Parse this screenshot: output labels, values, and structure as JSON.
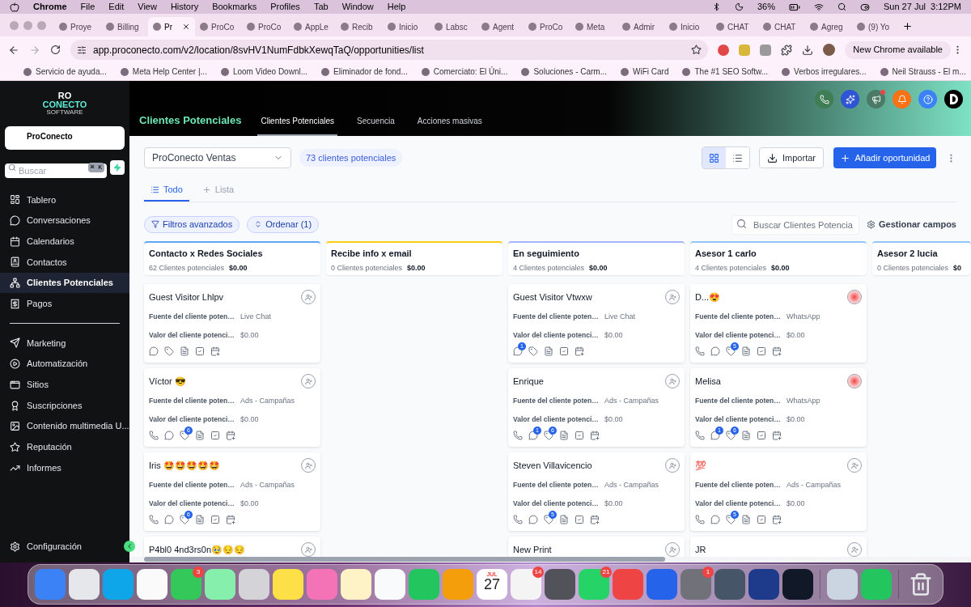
{
  "menubar": {
    "app": "Chrome",
    "menus": [
      "File",
      "Edit",
      "View",
      "History",
      "Bookmarks",
      "Profiles",
      "Tab",
      "Window",
      "Help"
    ],
    "battery": "36%",
    "clock": "Sun 27 Jul  3:12PM"
  },
  "browser_tabs": [
    {
      "title": "Proye",
      "selected": false
    },
    {
      "title": "Billing",
      "selected": false
    },
    {
      "title": "Pr",
      "selected": true
    },
    {
      "title": "ProCo",
      "selected": false
    },
    {
      "title": "ProCo",
      "selected": false
    },
    {
      "title": "AppLe",
      "selected": false
    },
    {
      "title": "Recib",
      "selected": false
    },
    {
      "title": "Inicio",
      "selected": false
    },
    {
      "title": "Labsc",
      "selected": false
    },
    {
      "title": "Agent",
      "selected": false
    },
    {
      "title": "ProCo",
      "selected": false
    },
    {
      "title": "Meta",
      "selected": false
    },
    {
      "title": "Admir",
      "selected": false
    },
    {
      "title": "Inicio",
      "selected": false
    },
    {
      "title": "CHAT",
      "selected": false
    },
    {
      "title": "CHAT",
      "selected": false
    },
    {
      "title": "Agreg",
      "selected": false
    },
    {
      "title": "(9) Yo",
      "selected": false
    }
  ],
  "address_bar": {
    "url": "app.proconecto.com/v2/location/8svHV1NumFdbkXewqTaQ/opportunities/list",
    "update_button": "New Chrome available"
  },
  "bookmarks": [
    "Servicio de ayuda...",
    "Meta Help Center |...",
    "Loom Video Downl...",
    "Eliminador de fond...",
    "Comerciato: El Úni...",
    "Soluciones - Carm...",
    "WiFi Card",
    "The #1 SEO Softw...",
    "Verbos irregulares...",
    "Neil Strauss - El m..."
  ],
  "sidebar": {
    "logo": {
      "top": "RO",
      "bottom": "CONECTO",
      "tagline": "SOFTWARE"
    },
    "account": "ProConecto",
    "search": {
      "placeholder": "Buscar",
      "shortcut": "⌘ K"
    },
    "nav_groups": [
      [
        {
          "label": "Tablero",
          "selected": false
        },
        {
          "label": "Conversaciones",
          "selected": false
        },
        {
          "label": "Calendarios",
          "selected": false
        },
        {
          "label": "Contactos",
          "selected": false
        },
        {
          "label": "Clientes Potenciales",
          "selected": true
        },
        {
          "label": "Pagos",
          "selected": false
        }
      ],
      [
        {
          "label": "Marketing",
          "selected": false
        },
        {
          "label": "Automatización",
          "selected": false
        },
        {
          "label": "Sitios",
          "selected": false
        },
        {
          "label": "Suscripciones",
          "selected": false
        },
        {
          "label": "Contenido multimedia U...",
          "selected": false
        },
        {
          "label": "Reputación",
          "selected": false
        },
        {
          "label": "Informes",
          "selected": false
        }
      ]
    ],
    "settings": "Configuración"
  },
  "header": {
    "title": "Clientes Potenciales",
    "tabs": [
      {
        "label": "Clientes Potenciales",
        "selected": true
      },
      {
        "label": "Secuencia",
        "selected": false
      },
      {
        "label": "Acciones masivas",
        "selected": false
      }
    ],
    "icons": [
      {
        "kind": "phone",
        "alert": false
      },
      {
        "kind": "ai",
        "alert": false
      },
      {
        "kind": "announce",
        "alert": true
      },
      {
        "kind": "bell",
        "alert": false
      },
      {
        "kind": "help",
        "alert": false
      },
      {
        "kind": "profile",
        "alert": false
      }
    ]
  },
  "toolbar": {
    "pipeline": "ProConecto Ventas",
    "count": "73 clientes potenciales",
    "view_modes": [
      {
        "kind": "grid",
        "selected": true
      },
      {
        "kind": "list",
        "selected": false
      }
    ],
    "import": "Importar",
    "add": "Añadir oportunidad"
  },
  "views": [
    {
      "kind": "view",
      "label": "Todo",
      "selected": true
    },
    {
      "kind": "add",
      "label": "Lista",
      "selected": false
    }
  ],
  "filters": {
    "advanced": "Filtros avanzados",
    "sort": "Ordenar (1)",
    "search_placeholder": "Buscar Clientes Potencia",
    "manage": "Gestionar campos"
  },
  "columns": [
    {
      "name": "Contacto x Redes Sociales",
      "count": "62 Clientes potenciales",
      "value": "$0.00",
      "color": "#60a5fa",
      "cards": [
        {
          "kind": "unassigned",
          "name": "Guest Visitor Lhlpv",
          "fields": [
            {
              "label": "Fuente del cliente poten…",
              "value": "Live Chat"
            },
            {
              "label": "Valor del cliente potenci…",
              "value": "$0.00"
            }
          ],
          "actions": [
            {
              "kind": "chat"
            },
            {
              "kind": "tag"
            },
            {
              "kind": "note"
            },
            {
              "kind": "task"
            },
            {
              "kind": "event"
            }
          ]
        },
        {
          "kind": "unassigned",
          "name": "Víctor 😎",
          "fields": [
            {
              "label": "Fuente del cliente poten…",
              "value": "Ads - Campañas"
            },
            {
              "label": "Valor del cliente potenci…",
              "value": "$0.00"
            }
          ],
          "actions": [
            {
              "kind": "phone"
            },
            {
              "kind": "chat"
            },
            {
              "kind": "tag",
              "badge": "6"
            },
            {
              "kind": "note"
            },
            {
              "kind": "task"
            },
            {
              "kind": "event"
            }
          ]
        },
        {
          "kind": "unassigned",
          "name": "Iris 🤩🤩🤩🤩🤩",
          "fields": [
            {
              "label": "Fuente del cliente poten…",
              "value": "Ads - Campañas"
            },
            {
              "label": "Valor del cliente potenci…",
              "value": "$0.00"
            }
          ],
          "actions": [
            {
              "kind": "phone"
            },
            {
              "kind": "chat"
            },
            {
              "kind": "tag",
              "badge": "6"
            },
            {
              "kind": "note"
            },
            {
              "kind": "task"
            },
            {
              "kind": "event"
            }
          ]
        },
        {
          "kind": "unassigned",
          "name": "P4bl0 4nd3rs0n🥹😔😔"
        }
      ]
    },
    {
      "name": "Recibe info x email",
      "count": "0 Clientes potenciales",
      "value": "$0.00",
      "color": "#facc15"
    },
    {
      "name": "En seguimiento",
      "count": "4 Clientes potenciales",
      "value": "$0.00",
      "color": "#a5b4fc",
      "cards": [
        {
          "kind": "unassigned",
          "name": "Guest Visitor Vtwxw",
          "fields": [
            {
              "label": "Fuente del cliente poten…",
              "value": "Live Chat"
            },
            {
              "label": "Valor del cliente potenci…",
              "value": "$0.00"
            }
          ],
          "actions": [
            {
              "kind": "chat",
              "badge": "1"
            },
            {
              "kind": "tag"
            },
            {
              "kind": "note"
            },
            {
              "kind": "task"
            },
            {
              "kind": "event"
            }
          ]
        },
        {
          "kind": "unassigned",
          "name": "Enrique",
          "fields": [
            {
              "label": "Fuente del cliente poten…",
              "value": "Ads - Campañas"
            },
            {
              "label": "Valor del cliente potenci…",
              "value": "$0.00"
            }
          ],
          "actions": [
            {
              "kind": "phone"
            },
            {
              "kind": "chat",
              "badge": "1"
            },
            {
              "kind": "tag",
              "badge": "6"
            },
            {
              "kind": "note"
            },
            {
              "kind": "task"
            },
            {
              "kind": "event"
            }
          ]
        },
        {
          "kind": "unassigned",
          "name": "Steven Villavicencio",
          "fields": [
            {
              "label": "Fuente del cliente poten…",
              "value": "Ads - Campañas"
            },
            {
              "label": "Valor del cliente potenci…",
              "value": "$0.00"
            }
          ],
          "actions": [
            {
              "kind": "phone"
            },
            {
              "kind": "chat"
            },
            {
              "kind": "tag",
              "badge": "5"
            },
            {
              "kind": "note"
            },
            {
              "kind": "task"
            },
            {
              "kind": "event"
            }
          ]
        },
        {
          "kind": "unassigned",
          "name": "New Print"
        }
      ]
    },
    {
      "name": "Asesor 1 carlo",
      "count": "4 Clientes potenciales",
      "value": "$0.00",
      "color": "#93c5fd",
      "cards": [
        {
          "kind": "assigned",
          "name": "D...😍",
          "fields": [
            {
              "label": "Fuente del cliente poten…",
              "value": "WhatsApp"
            },
            {
              "label": "Valor del cliente potenci…",
              "value": "$0.00"
            }
          ],
          "actions": [
            {
              "kind": "phone"
            },
            {
              "kind": "chat"
            },
            {
              "kind": "tag",
              "badge": "5"
            },
            {
              "kind": "note"
            },
            {
              "kind": "task"
            },
            {
              "kind": "event"
            }
          ]
        },
        {
          "kind": "assigned",
          "name": "Melisa",
          "fields": [
            {
              "label": "Fuente del cliente poten…",
              "value": "WhatsApp"
            },
            {
              "label": "Valor del cliente potenci…",
              "value": "$0.00"
            }
          ],
          "actions": [
            {
              "kind": "phone"
            },
            {
              "kind": "chat",
              "badge": "1"
            },
            {
              "kind": "tag",
              "badge": "6"
            },
            {
              "kind": "note"
            },
            {
              "kind": "task"
            },
            {
              "kind": "event"
            }
          ]
        },
        {
          "kind": "unassigned",
          "name": "💯",
          "fields": [
            {
              "label": "Fuente del cliente poten…",
              "value": "Ads - Campañas"
            },
            {
              "label": "Valor del cliente potenci…",
              "value": "$0.00"
            }
          ],
          "actions": [
            {
              "kind": "phone"
            },
            {
              "kind": "chat"
            },
            {
              "kind": "tag",
              "badge": "5"
            },
            {
              "kind": "note"
            },
            {
              "kind": "task"
            },
            {
              "kind": "event"
            }
          ]
        },
        {
          "kind": "unassigned",
          "name": "JR"
        }
      ]
    },
    {
      "name": "Asesor 2 lucia",
      "count": "0 Clientes potenciales",
      "value": "$0",
      "color": "#93c5fd"
    }
  ],
  "dock": {
    "apps": [
      {
        "kind": "app",
        "color": "#3b82f6"
      },
      {
        "kind": "app",
        "color": "#e5e7eb"
      },
      {
        "kind": "app",
        "color": "#0ea5e9"
      },
      {
        "kind": "app",
        "color": "#fafafa"
      },
      {
        "kind": "app",
        "color": "#34c759",
        "badge": "3"
      },
      {
        "kind": "app",
        "color": "#86efac"
      },
      {
        "kind": "app",
        "color": "#d4d4d8"
      },
      {
        "kind": "app",
        "color": "#fde047"
      },
      {
        "kind": "app",
        "color": "#f472b6"
      },
      {
        "kind": "app",
        "color": "#fef3c7"
      },
      {
        "kind": "app",
        "color": "#f8fafc"
      },
      {
        "kind": "app",
        "color": "#22c55e"
      },
      {
        "kind": "app",
        "color": "#f59e0b"
      },
      {
        "kind": "calendar",
        "month": "JUL",
        "day": "27"
      },
      {
        "kind": "app",
        "color": "#f4f4f5",
        "badge": "14"
      },
      {
        "kind": "app",
        "color": "#52525b"
      },
      {
        "kind": "app",
        "color": "#25d366",
        "badge": "21"
      },
      {
        "kind": "app",
        "color": "#ef4444"
      },
      {
        "kind": "app",
        "color": "#2563eb"
      },
      {
        "kind": "app",
        "color": "#71717a",
        "badge": "1"
      },
      {
        "kind": "app",
        "color": "#475569"
      },
      {
        "kind": "app",
        "color": "#1e3a8a"
      },
      {
        "kind": "app",
        "color": "#111827"
      }
    ],
    "recents": [
      {
        "kind": "app",
        "color": "#cbd5e1"
      },
      {
        "kind": "app",
        "color": "#22c55e"
      }
    ]
  }
}
